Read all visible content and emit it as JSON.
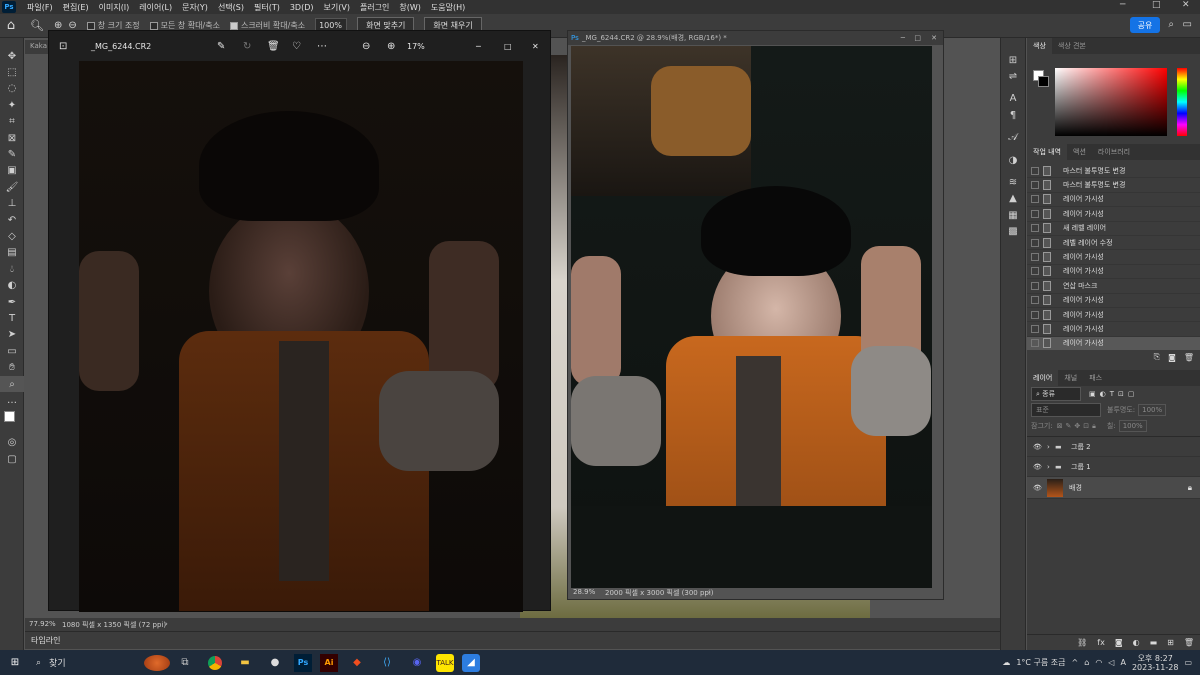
{
  "menubar": {
    "logo": "Ps",
    "items": [
      "파일(F)",
      "편집(E)",
      "이미지(I)",
      "레이어(L)",
      "문자(Y)",
      "선택(S)",
      "필터(T)",
      "3D(D)",
      "보기(V)",
      "플러그인",
      "창(W)",
      "도움말(H)"
    ],
    "minimize": "─",
    "maximize": "□",
    "close": "✕"
  },
  "options": {
    "scroll_all": "창 크기 조정",
    "zoom_all": "모든 창 확대/축소",
    "scrubby": "스크러비 확대/축소",
    "zoom_value": "100%",
    "fit_screen": "화면 맞추기",
    "fill_screen": "화면 채우기",
    "share": "공유"
  },
  "doc_tab": "Kaka",
  "viewer": {
    "filename": "_MG_6244.CR2",
    "zoom": "17%",
    "status_zoom": "77.92%",
    "status_dims": "1080 픽셀 x 1350 픽셀 (72 ppi)"
  },
  "psdoc": {
    "title": "_MG_6244.CR2 @ 28.9%(배경, RGB/16*) *",
    "status_zoom": "28.9%",
    "status_dims": "2000 픽셀 x 3000 픽셀 (300 ppi)"
  },
  "timeline": "타임라인",
  "color_panel": {
    "tabs": [
      "색상",
      "색상 견본"
    ],
    "fg": "#ffffff",
    "bg": "#000000",
    "accent": "#ff0000"
  },
  "history": {
    "tabs": [
      "작업 내역",
      "액션",
      "라이브러리"
    ],
    "items": [
      "마스터 불투명도 변경",
      "마스터 불투명도 변경",
      "레이어 가시성",
      "레이어 가시성",
      "새 레벨 레이어",
      "레벨 레이어 수정",
      "레이어 가시성",
      "레이어 가시성",
      "연삽 마스크",
      "레이어 가시성",
      "레이어 가시성",
      "레이어 가시성",
      "레이어 가시성"
    ]
  },
  "layers": {
    "tabs": [
      "레이어",
      "채널",
      "패스"
    ],
    "filter": "종류",
    "blend": "표준",
    "opacity_label": "불투명도:",
    "opacity": "100%",
    "lock_label": "잠그기:",
    "fill_label": "칠:",
    "fill": "100%",
    "rows": [
      {
        "name": "그룹 2"
      },
      {
        "name": "그룹 1"
      },
      {
        "name": "배경"
      }
    ]
  },
  "taskbar": {
    "search": "찾기",
    "weather": "1°C 구름 조금",
    "ime": "A",
    "time": "오후 8:27",
    "date": "2023-11-28"
  },
  "colors": {
    "bg": "#535353",
    "panel": "#3c3c3c",
    "accent": "#1473e6",
    "vest": "#b4551a"
  }
}
